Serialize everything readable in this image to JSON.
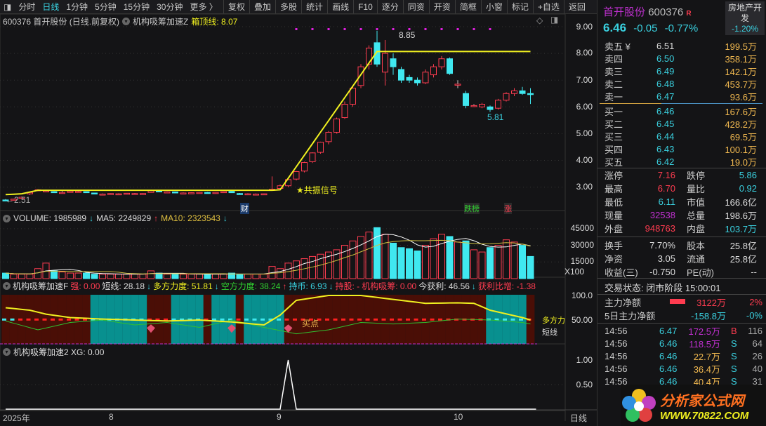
{
  "toolbar": {
    "periods": [
      "分时",
      "日线",
      "1分钟",
      "5分钟",
      "15分钟",
      "30分钟",
      "更多 〉"
    ],
    "active": "日线",
    "buttons": [
      "复权",
      "叠加",
      "多股",
      "统计",
      "画线",
      "F10",
      "逐分",
      "同资",
      "开资",
      "简框",
      "小窗",
      "标记",
      "+自选",
      "返回"
    ]
  },
  "main": {
    "title": "600376 首开股份 (日线.前复权)",
    "indicator": "机构吸筹加速Z",
    "box_label": "箱顶线: 8.07",
    "high_label": "8.85",
    "low_label": "5.81",
    "start_label": "2.51",
    "signal_label": "共振信号",
    "badge_cai": "财",
    "badge_dieb": "跌榜",
    "badge_zhang": "涨",
    "axis": [
      "9.00",
      "8.00",
      "7.00",
      "6.00",
      "5.00",
      "4.00",
      "3.00"
    ]
  },
  "volume": {
    "label": "VOLUME: 1985989",
    "ma5": "MA5: 2249829",
    "ma10": "MA10: 2323543",
    "axis": [
      "45000",
      "30000",
      "15000"
    ],
    "unit": "X100"
  },
  "ind": {
    "name": "机构吸筹加速F",
    "strong": "强: 0.00",
    "short": "短线: 28.18",
    "bull": "多方力度: 51.81",
    "bear": "空方力度: 38.24",
    "coin": "持币: 6.93",
    "hold": "持股: -",
    "inst": "机构吸筹: 0.00",
    "profit": "今获利: 46.56",
    "ratio": "获利比增: -1.38",
    "buy_label": "买点",
    "right_bull": "多方力",
    "right_short": "短线",
    "axis": [
      "100.0",
      "50.00"
    ]
  },
  "xg": {
    "label": "机构吸筹加速2  XG: 0.00",
    "axis": [
      "1.00",
      "0.50"
    ]
  },
  "xaxis": {
    "labels": [
      "2025年",
      "8",
      "9",
      "10"
    ],
    "period": "日线"
  },
  "chart_data": {
    "type": "candlestick",
    "price_range": [
      2.3,
      9.1
    ],
    "candles": [
      [
        2.52,
        2.55,
        2.49,
        2.51
      ],
      [
        2.51,
        2.56,
        2.5,
        2.55
      ],
      [
        2.6,
        2.65,
        2.58,
        2.62
      ],
      [
        2.75,
        2.82,
        2.7,
        2.8
      ],
      [
        2.88,
        2.92,
        2.85,
        2.9
      ],
      [
        2.85,
        2.9,
        2.82,
        2.86
      ],
      [
        2.83,
        2.85,
        2.8,
        2.81
      ],
      [
        2.8,
        2.85,
        2.78,
        2.8
      ],
      [
        2.8,
        2.86,
        2.8,
        2.85
      ],
      [
        2.84,
        2.86,
        2.82,
        2.84
      ],
      [
        2.83,
        2.84,
        2.79,
        2.8
      ],
      [
        2.78,
        2.79,
        2.74,
        2.75
      ],
      [
        2.74,
        2.76,
        2.72,
        2.74
      ],
      [
        2.74,
        2.77,
        2.72,
        2.76
      ],
      [
        2.75,
        2.77,
        2.73,
        2.75
      ],
      [
        2.74,
        2.78,
        2.73,
        2.77
      ],
      [
        2.76,
        2.78,
        2.74,
        2.76
      ],
      [
        2.76,
        2.77,
        2.74,
        2.76
      ],
      [
        2.8,
        2.88,
        2.79,
        2.86
      ],
      [
        2.86,
        2.87,
        2.81,
        2.82
      ],
      [
        2.8,
        2.84,
        2.78,
        2.82
      ],
      [
        2.82,
        2.83,
        2.78,
        2.79
      ],
      [
        2.78,
        2.8,
        2.77,
        2.78
      ],
      [
        2.77,
        2.8,
        2.76,
        2.79
      ],
      [
        2.79,
        2.81,
        2.77,
        2.8
      ],
      [
        2.8,
        2.82,
        2.78,
        2.79
      ],
      [
        2.76,
        2.8,
        2.75,
        2.8
      ],
      [
        2.8,
        2.84,
        2.79,
        2.83
      ],
      [
        2.84,
        2.85,
        2.78,
        2.79
      ],
      [
        2.76,
        2.78,
        2.74,
        2.75
      ],
      [
        2.75,
        2.77,
        2.73,
        2.75
      ],
      [
        2.74,
        2.76,
        2.72,
        2.74
      ],
      [
        2.74,
        2.76,
        2.73,
        2.75
      ],
      [
        2.88,
        3.4,
        2.86,
        2.92
      ],
      [
        2.95,
        3.1,
        2.9,
        3.05
      ],
      [
        3.05,
        3.3,
        3.0,
        3.28
      ],
      [
        3.3,
        3.6,
        3.25,
        3.58
      ],
      [
        3.6,
        3.95,
        3.55,
        3.92
      ],
      [
        3.95,
        4.3,
        3.9,
        4.28
      ],
      [
        4.3,
        4.7,
        4.25,
        4.68
      ],
      [
        4.7,
        5.1,
        4.6,
        5.05
      ],
      [
        5.05,
        5.6,
        5.0,
        5.55
      ],
      [
        5.6,
        6.2,
        5.55,
        6.1
      ],
      [
        6.1,
        6.8,
        6.0,
        6.7
      ],
      [
        6.8,
        7.6,
        6.7,
        7.5
      ],
      [
        7.6,
        8.3,
        7.4,
        8.2
      ],
      [
        8.4,
        8.85,
        7.5,
        7.6
      ],
      [
        7.3,
        8.5,
        6.8,
        8.0
      ],
      [
        7.8,
        8.0,
        7.2,
        7.5
      ],
      [
        7.4,
        7.5,
        6.9,
        7.0
      ],
      [
        7.1,
        7.2,
        6.9,
        7.0
      ],
      [
        7.0,
        7.1,
        6.8,
        6.9
      ],
      [
        6.9,
        7.4,
        6.85,
        7.3
      ],
      [
        7.2,
        7.6,
        7.1,
        7.5
      ],
      [
        7.5,
        7.9,
        7.4,
        7.8
      ],
      [
        7.8,
        7.85,
        7.2,
        7.25
      ],
      [
        6.85,
        7.0,
        6.7,
        6.85
      ],
      [
        6.5,
        6.6,
        5.95,
        6.05
      ],
      [
        6.05,
        6.1,
        6.0,
        6.05
      ],
      [
        6.0,
        6.15,
        5.95,
        6.1
      ],
      [
        6.0,
        6.05,
        5.81,
        5.9
      ],
      [
        5.95,
        6.3,
        5.9,
        6.25
      ],
      [
        6.25,
        6.55,
        6.2,
        6.5
      ],
      [
        6.5,
        6.7,
        6.4,
        6.6
      ],
      [
        6.6,
        6.75,
        6.45,
        6.5
      ],
      [
        6.5,
        6.7,
        6.11,
        6.46
      ]
    ],
    "volume": [
      5000,
      4000,
      4000,
      4000,
      9000,
      14000,
      7000,
      6000,
      5000,
      5000,
      5000,
      4000,
      4000,
      4000,
      4000,
      4000,
      4000,
      4000,
      7000,
      5000,
      4000,
      4000,
      4000,
      4000,
      4000,
      4000,
      4000,
      4000,
      5000,
      4000,
      4000,
      4000,
      4000,
      11000,
      9000,
      14000,
      16000,
      18000,
      20000,
      22000,
      24000,
      26000,
      30000,
      34000,
      38000,
      42000,
      46000,
      40000,
      32000,
      28000,
      27000,
      25000,
      30000,
      36000,
      40000,
      38000,
      33000,
      34000,
      26000,
      24000,
      28000,
      30000,
      35000,
      33000,
      30000,
      20000
    ],
    "box_top_knots": [
      [
        0,
        2.72
      ],
      [
        2,
        2.75
      ],
      [
        4,
        2.88
      ],
      [
        33,
        2.88
      ],
      [
        34,
        2.9
      ],
      [
        46,
        8.07
      ],
      [
        65,
        8.07
      ]
    ],
    "bull_knots": [
      [
        0,
        75
      ],
      [
        3,
        70
      ],
      [
        5,
        62
      ],
      [
        8,
        55
      ],
      [
        12,
        52
      ],
      [
        16,
        50
      ],
      [
        20,
        48
      ],
      [
        24,
        50
      ],
      [
        28,
        46
      ],
      [
        32,
        40
      ],
      [
        34,
        60
      ],
      [
        36,
        90
      ],
      [
        40,
        100
      ],
      [
        44,
        100
      ],
      [
        48,
        92
      ],
      [
        52,
        84
      ],
      [
        56,
        85
      ],
      [
        58,
        84
      ],
      [
        60,
        70
      ],
      [
        64,
        55
      ],
      [
        65,
        50
      ]
    ],
    "green_knots": [
      [
        0,
        48
      ],
      [
        4,
        30
      ],
      [
        8,
        45
      ],
      [
        12,
        50
      ],
      [
        16,
        40
      ],
      [
        20,
        45
      ],
      [
        24,
        35
      ],
      [
        28,
        50
      ],
      [
        32,
        35
      ],
      [
        36,
        22
      ],
      [
        40,
        30
      ],
      [
        44,
        45
      ],
      [
        48,
        42
      ],
      [
        52,
        45
      ],
      [
        56,
        52
      ],
      [
        60,
        50
      ],
      [
        64,
        45
      ],
      [
        65,
        42
      ]
    ],
    "regime_bull_ranges": [
      [
        11,
        18
      ],
      [
        21,
        25
      ],
      [
        26,
        29
      ],
      [
        30,
        35
      ],
      [
        60,
        65
      ]
    ],
    "xg_spike_index": 35
  },
  "quote": {
    "name": "首开股份",
    "code": "600376",
    "r": "R",
    "price": "6.46",
    "change": "-0.05",
    "pct": "-0.77%",
    "sector": "房地产开发",
    "sector_pct": "-1.20%",
    "asks": [
      [
        "卖五 ¥",
        "6.51",
        "199.5万"
      ],
      [
        "卖四",
        "6.50",
        "358.1万"
      ],
      [
        "卖三",
        "6.49",
        "142.1万"
      ],
      [
        "卖二",
        "6.48",
        "453.7万"
      ],
      [
        "卖一",
        "6.47",
        "93.6万"
      ]
    ],
    "bids": [
      [
        "买一",
        "6.46",
        "167.6万"
      ],
      [
        "买二",
        "6.45",
        "428.2万"
      ],
      [
        "买三",
        "6.44",
        "69.5万"
      ],
      [
        "买四",
        "6.43",
        "100.1万"
      ],
      [
        "买五",
        "6.42",
        "19.0万"
      ]
    ],
    "stats": [
      [
        "涨停",
        "7.16",
        "跌停",
        "5.86"
      ],
      [
        "最高",
        "6.70",
        "量比",
        "0.92"
      ],
      [
        "最低",
        "6.11",
        "市值",
        "166.6亿"
      ],
      [
        "现量",
        "32538",
        "总量",
        "198.6万"
      ],
      [
        "外盘",
        "948763",
        "内盘",
        "103.7万"
      ]
    ],
    "stats2": [
      [
        "换手",
        "7.70%",
        "股本",
        "25.8亿"
      ],
      [
        "净资",
        "3.05",
        "流通",
        "25.8亿"
      ],
      [
        "收益(三)",
        "-0.750",
        "PE(动)",
        "--"
      ]
    ],
    "status": "交易状态: 闭市阶段 15:00:01",
    "flow": [
      [
        "主力净额",
        "3122万",
        "2%"
      ],
      [
        "5日主力净额",
        "-158.8万",
        "-0%"
      ]
    ],
    "ticks": [
      [
        "14:56",
        "6.47",
        "172.5万",
        "B",
        "116"
      ],
      [
        "14:56",
        "6.46",
        "118.5万",
        "S",
        "64"
      ],
      [
        "14:56",
        "6.46",
        "22.7万",
        "S",
        "26"
      ],
      [
        "14:56",
        "6.46",
        "36.4万",
        "S",
        "40"
      ],
      [
        "14:56",
        "6.46",
        "40.4万",
        "S",
        "31"
      ]
    ],
    "watermark": {
      "cn": "分析家公式网",
      "url": "WWW.70822.COM"
    }
  }
}
